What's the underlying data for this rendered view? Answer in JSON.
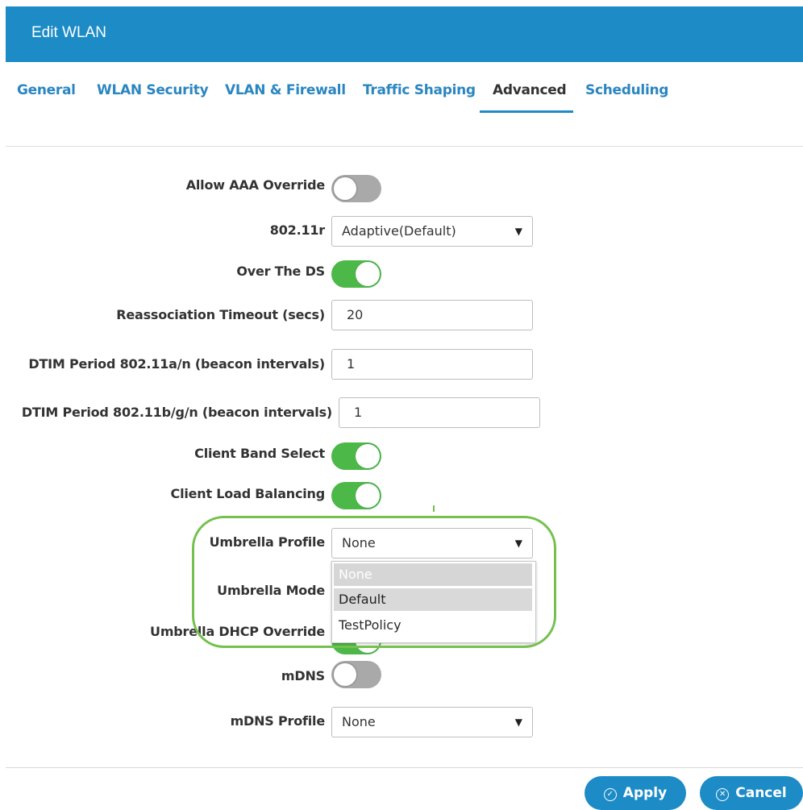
{
  "header": {
    "title": "Edit WLAN"
  },
  "tabs": [
    {
      "label": "General"
    },
    {
      "label": "WLAN Security"
    },
    {
      "label": "VLAN & Firewall"
    },
    {
      "label": "Traffic Shaping"
    },
    {
      "label": "Advanced"
    },
    {
      "label": "Scheduling"
    }
  ],
  "active_tab": "Advanced",
  "form": {
    "allow_aaa_override": {
      "label": "Allow AAA Override",
      "state": "off"
    },
    "dot11r": {
      "label": "802.11r",
      "value": "Adaptive(Default)"
    },
    "over_the_ds": {
      "label": "Over The DS",
      "state": "on"
    },
    "reassociation_timeout": {
      "label": "Reassociation Timeout (secs)",
      "value": "20"
    },
    "dtim_an": {
      "label": "DTIM Period 802.11a/n (beacon intervals)",
      "value": "1"
    },
    "dtim_bgn": {
      "label": "DTIM Period 802.11b/g/n (beacon intervals)",
      "value": "1"
    },
    "client_band_select": {
      "label": "Client Band Select",
      "state": "on"
    },
    "client_load_balancing": {
      "label": "Client Load Balancing",
      "state": "on"
    },
    "umbrella_profile": {
      "label": "Umbrella Profile",
      "value": "None",
      "options": [
        "None",
        "Default",
        "TestPolicy"
      ]
    },
    "umbrella_mode": {
      "label": "Umbrella Mode"
    },
    "umbrella_dhcp_override": {
      "label": "Umbrella DHCP Override"
    },
    "mdns": {
      "label": "mDNS",
      "state": "off"
    },
    "mdns_profile": {
      "label": "mDNS Profile",
      "value": "None"
    }
  },
  "footer": {
    "apply_label": "Apply",
    "cancel_label": "Cancel"
  },
  "colors": {
    "header": "#1c8bc6",
    "toggle_on": "#4cb848",
    "toggle_off": "#a9a9a9",
    "highlight": "#74c14d"
  }
}
